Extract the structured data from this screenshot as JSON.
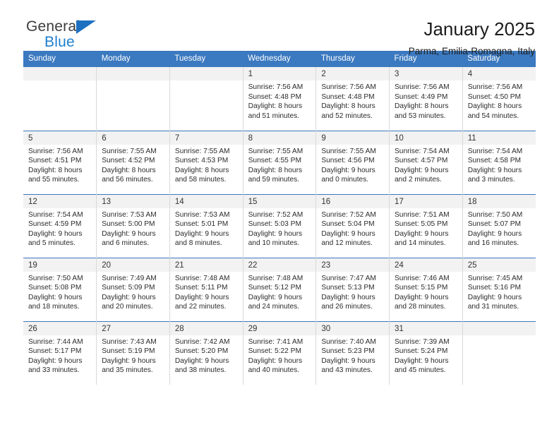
{
  "brand": {
    "word1": "General",
    "word2": "Blue",
    "flag_color": "#1d6fc0",
    "blue_color": "#1d7fd0"
  },
  "header": {
    "title": "January 2025",
    "subtitle": "Parma, Emilia-Romagna, Italy",
    "accent_color": "#3b79c0"
  },
  "calendar": {
    "weekdays": [
      "Sunday",
      "Monday",
      "Tuesday",
      "Wednesday",
      "Thursday",
      "Friday",
      "Saturday"
    ],
    "weeks": [
      [
        {
          "day": "",
          "sunrise": "",
          "sunset": "",
          "daylight1": "",
          "daylight2": ""
        },
        {
          "day": "",
          "sunrise": "",
          "sunset": "",
          "daylight1": "",
          "daylight2": ""
        },
        {
          "day": "",
          "sunrise": "",
          "sunset": "",
          "daylight1": "",
          "daylight2": ""
        },
        {
          "day": "1",
          "sunrise": "Sunrise: 7:56 AM",
          "sunset": "Sunset: 4:48 PM",
          "daylight1": "Daylight: 8 hours",
          "daylight2": "and 51 minutes."
        },
        {
          "day": "2",
          "sunrise": "Sunrise: 7:56 AM",
          "sunset": "Sunset: 4:48 PM",
          "daylight1": "Daylight: 8 hours",
          "daylight2": "and 52 minutes."
        },
        {
          "day": "3",
          "sunrise": "Sunrise: 7:56 AM",
          "sunset": "Sunset: 4:49 PM",
          "daylight1": "Daylight: 8 hours",
          "daylight2": "and 53 minutes."
        },
        {
          "day": "4",
          "sunrise": "Sunrise: 7:56 AM",
          "sunset": "Sunset: 4:50 PM",
          "daylight1": "Daylight: 8 hours",
          "daylight2": "and 54 minutes."
        }
      ],
      [
        {
          "day": "5",
          "sunrise": "Sunrise: 7:56 AM",
          "sunset": "Sunset: 4:51 PM",
          "daylight1": "Daylight: 8 hours",
          "daylight2": "and 55 minutes."
        },
        {
          "day": "6",
          "sunrise": "Sunrise: 7:55 AM",
          "sunset": "Sunset: 4:52 PM",
          "daylight1": "Daylight: 8 hours",
          "daylight2": "and 56 minutes."
        },
        {
          "day": "7",
          "sunrise": "Sunrise: 7:55 AM",
          "sunset": "Sunset: 4:53 PM",
          "daylight1": "Daylight: 8 hours",
          "daylight2": "and 58 minutes."
        },
        {
          "day": "8",
          "sunrise": "Sunrise: 7:55 AM",
          "sunset": "Sunset: 4:55 PM",
          "daylight1": "Daylight: 8 hours",
          "daylight2": "and 59 minutes."
        },
        {
          "day": "9",
          "sunrise": "Sunrise: 7:55 AM",
          "sunset": "Sunset: 4:56 PM",
          "daylight1": "Daylight: 9 hours",
          "daylight2": "and 0 minutes."
        },
        {
          "day": "10",
          "sunrise": "Sunrise: 7:54 AM",
          "sunset": "Sunset: 4:57 PM",
          "daylight1": "Daylight: 9 hours",
          "daylight2": "and 2 minutes."
        },
        {
          "day": "11",
          "sunrise": "Sunrise: 7:54 AM",
          "sunset": "Sunset: 4:58 PM",
          "daylight1": "Daylight: 9 hours",
          "daylight2": "and 3 minutes."
        }
      ],
      [
        {
          "day": "12",
          "sunrise": "Sunrise: 7:54 AM",
          "sunset": "Sunset: 4:59 PM",
          "daylight1": "Daylight: 9 hours",
          "daylight2": "and 5 minutes."
        },
        {
          "day": "13",
          "sunrise": "Sunrise: 7:53 AM",
          "sunset": "Sunset: 5:00 PM",
          "daylight1": "Daylight: 9 hours",
          "daylight2": "and 6 minutes."
        },
        {
          "day": "14",
          "sunrise": "Sunrise: 7:53 AM",
          "sunset": "Sunset: 5:01 PM",
          "daylight1": "Daylight: 9 hours",
          "daylight2": "and 8 minutes."
        },
        {
          "day": "15",
          "sunrise": "Sunrise: 7:52 AM",
          "sunset": "Sunset: 5:03 PM",
          "daylight1": "Daylight: 9 hours",
          "daylight2": "and 10 minutes."
        },
        {
          "day": "16",
          "sunrise": "Sunrise: 7:52 AM",
          "sunset": "Sunset: 5:04 PM",
          "daylight1": "Daylight: 9 hours",
          "daylight2": "and 12 minutes."
        },
        {
          "day": "17",
          "sunrise": "Sunrise: 7:51 AM",
          "sunset": "Sunset: 5:05 PM",
          "daylight1": "Daylight: 9 hours",
          "daylight2": "and 14 minutes."
        },
        {
          "day": "18",
          "sunrise": "Sunrise: 7:50 AM",
          "sunset": "Sunset: 5:07 PM",
          "daylight1": "Daylight: 9 hours",
          "daylight2": "and 16 minutes."
        }
      ],
      [
        {
          "day": "19",
          "sunrise": "Sunrise: 7:50 AM",
          "sunset": "Sunset: 5:08 PM",
          "daylight1": "Daylight: 9 hours",
          "daylight2": "and 18 minutes."
        },
        {
          "day": "20",
          "sunrise": "Sunrise: 7:49 AM",
          "sunset": "Sunset: 5:09 PM",
          "daylight1": "Daylight: 9 hours",
          "daylight2": "and 20 minutes."
        },
        {
          "day": "21",
          "sunrise": "Sunrise: 7:48 AM",
          "sunset": "Sunset: 5:11 PM",
          "daylight1": "Daylight: 9 hours",
          "daylight2": "and 22 minutes."
        },
        {
          "day": "22",
          "sunrise": "Sunrise: 7:48 AM",
          "sunset": "Sunset: 5:12 PM",
          "daylight1": "Daylight: 9 hours",
          "daylight2": "and 24 minutes."
        },
        {
          "day": "23",
          "sunrise": "Sunrise: 7:47 AM",
          "sunset": "Sunset: 5:13 PM",
          "daylight1": "Daylight: 9 hours",
          "daylight2": "and 26 minutes."
        },
        {
          "day": "24",
          "sunrise": "Sunrise: 7:46 AM",
          "sunset": "Sunset: 5:15 PM",
          "daylight1": "Daylight: 9 hours",
          "daylight2": "and 28 minutes."
        },
        {
          "day": "25",
          "sunrise": "Sunrise: 7:45 AM",
          "sunset": "Sunset: 5:16 PM",
          "daylight1": "Daylight: 9 hours",
          "daylight2": "and 31 minutes."
        }
      ],
      [
        {
          "day": "26",
          "sunrise": "Sunrise: 7:44 AM",
          "sunset": "Sunset: 5:17 PM",
          "daylight1": "Daylight: 9 hours",
          "daylight2": "and 33 minutes."
        },
        {
          "day": "27",
          "sunrise": "Sunrise: 7:43 AM",
          "sunset": "Sunset: 5:19 PM",
          "daylight1": "Daylight: 9 hours",
          "daylight2": "and 35 minutes."
        },
        {
          "day": "28",
          "sunrise": "Sunrise: 7:42 AM",
          "sunset": "Sunset: 5:20 PM",
          "daylight1": "Daylight: 9 hours",
          "daylight2": "and 38 minutes."
        },
        {
          "day": "29",
          "sunrise": "Sunrise: 7:41 AM",
          "sunset": "Sunset: 5:22 PM",
          "daylight1": "Daylight: 9 hours",
          "daylight2": "and 40 minutes."
        },
        {
          "day": "30",
          "sunrise": "Sunrise: 7:40 AM",
          "sunset": "Sunset: 5:23 PM",
          "daylight1": "Daylight: 9 hours",
          "daylight2": "and 43 minutes."
        },
        {
          "day": "31",
          "sunrise": "Sunrise: 7:39 AM",
          "sunset": "Sunset: 5:24 PM",
          "daylight1": "Daylight: 9 hours",
          "daylight2": "and 45 minutes."
        },
        {
          "day": "",
          "sunrise": "",
          "sunset": "",
          "daylight1": "",
          "daylight2": ""
        }
      ]
    ]
  }
}
